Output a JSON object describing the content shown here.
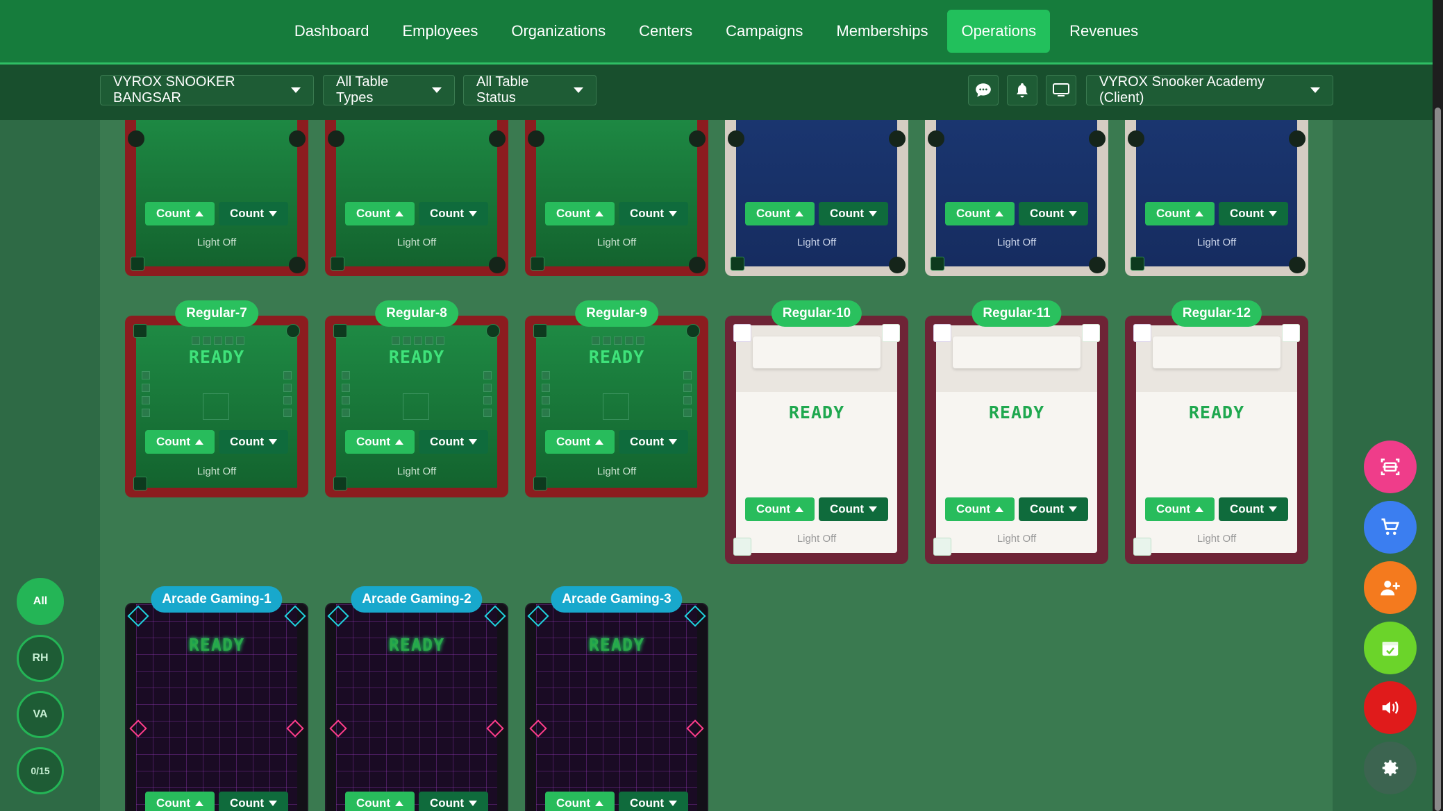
{
  "nav": {
    "items": [
      {
        "label": "Dashboard",
        "active": false
      },
      {
        "label": "Employees",
        "active": false
      },
      {
        "label": "Organizations",
        "active": false
      },
      {
        "label": "Centers",
        "active": false
      },
      {
        "label": "Campaigns",
        "active": false
      },
      {
        "label": "Memberships",
        "active": false
      },
      {
        "label": "Operations",
        "active": true
      },
      {
        "label": "Revenues",
        "active": false
      }
    ]
  },
  "filters": {
    "center": "VYROX SNOOKER BANGSAR",
    "table_types": "All Table Types",
    "table_status": "All Table Status",
    "account": "VYROX Snooker Academy (Client)"
  },
  "tables_row1": [
    {
      "style": "snooker",
      "light": "Light Off",
      "count_up": "Count",
      "count_down": "Count"
    },
    {
      "style": "snooker",
      "light": "Light Off",
      "count_up": "Count",
      "count_down": "Count"
    },
    {
      "style": "snooker",
      "light": "Light Off",
      "count_up": "Count",
      "count_down": "Count"
    },
    {
      "style": "pool",
      "light": "Light Off",
      "count_up": "Count",
      "count_down": "Count"
    },
    {
      "style": "pool",
      "light": "Light Off",
      "count_up": "Count",
      "count_down": "Count"
    },
    {
      "style": "pool",
      "light": "Light Off",
      "count_up": "Count",
      "count_down": "Count"
    }
  ],
  "tables_row2": [
    {
      "name": "Regular-7",
      "style": "snooker",
      "status": "READY",
      "light": "Light Off",
      "count_up": "Count",
      "count_down": "Count"
    },
    {
      "name": "Regular-8",
      "style": "snooker",
      "status": "READY",
      "light": "Light Off",
      "count_up": "Count",
      "count_down": "Count"
    },
    {
      "name": "Regular-9",
      "style": "snooker",
      "status": "READY",
      "light": "Light Off",
      "count_up": "Count",
      "count_down": "Count"
    },
    {
      "name": "Regular-10",
      "style": "white",
      "status": "READY",
      "light": "Light Off",
      "count_up": "Count",
      "count_down": "Count"
    },
    {
      "name": "Regular-11",
      "style": "white",
      "status": "READY",
      "light": "Light Off",
      "count_up": "Count",
      "count_down": "Count"
    },
    {
      "name": "Regular-12",
      "style": "white",
      "status": "READY",
      "light": "Light Off",
      "count_up": "Count",
      "count_down": "Count"
    }
  ],
  "tables_row3": [
    {
      "name": "Arcade Gaming-1",
      "style": "arcade",
      "status": "READY",
      "count_up": "Count",
      "count_down": "Count"
    },
    {
      "name": "Arcade Gaming-2",
      "style": "arcade",
      "status": "READY",
      "count_up": "Count",
      "count_down": "Count"
    },
    {
      "name": "Arcade Gaming-3",
      "style": "arcade",
      "status": "READY",
      "count_up": "Count",
      "count_down": "Count"
    }
  ],
  "left_filters": [
    "All",
    "RH",
    "VA",
    "0/15"
  ],
  "fabs": [
    {
      "icon": "scan-icon",
      "color": "#ef3d8a"
    },
    {
      "icon": "cart-icon",
      "color": "#3b7ef0"
    },
    {
      "icon": "add-user-icon",
      "color": "#f47a1e"
    },
    {
      "icon": "calendar-check-icon",
      "color": "#6bd42a"
    },
    {
      "icon": "volume-icon",
      "color": "#e01b1b"
    },
    {
      "icon": "gear-icon",
      "color": "#3c6450"
    }
  ],
  "colors": {
    "accent": "#22c05c",
    "nav_bg": "#167c3c",
    "content_bg": "#3a7a50"
  }
}
